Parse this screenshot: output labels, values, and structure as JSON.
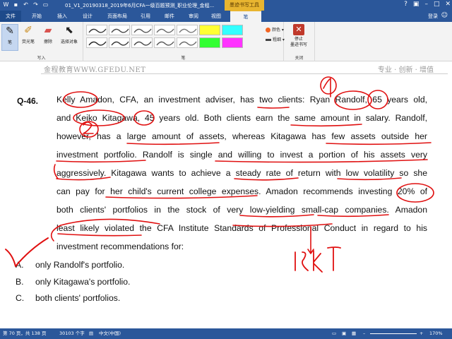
{
  "window": {
    "title": "01_V1_20190318_2019年6月CFA一级百题预测_职业伦理_金程...",
    "context_tool": "墨迹书写工具",
    "login": "登录"
  },
  "tabs": [
    "文件",
    "开始",
    "插入",
    "设计",
    "页面布局",
    "引用",
    "邮件",
    "审阅",
    "视图",
    "笔"
  ],
  "ribbon": {
    "write_group": {
      "label": "写入",
      "tools": [
        {
          "label": "笔",
          "icon": "pen-icon"
        },
        {
          "label": "荧光笔",
          "icon": "highlighter-icon"
        },
        {
          "label": "擦除",
          "icon": "eraser-icon"
        },
        {
          "label": "选择对象",
          "icon": "select-cursor-icon"
        }
      ]
    },
    "pens_group": {
      "label": "笔",
      "swatches": [
        {
          "color": "#333333",
          "kind": "line"
        },
        {
          "color": "#444444",
          "kind": "line"
        },
        {
          "color": "#555555",
          "kind": "line"
        },
        {
          "color": "#666666",
          "kind": "line"
        },
        {
          "color": "#777777",
          "kind": "line"
        },
        {
          "color": "#ffff33",
          "kind": "highlight"
        },
        {
          "color": "#33ffff",
          "kind": "highlight"
        },
        {
          "color": "#222222",
          "kind": "line"
        },
        {
          "color": "#333333",
          "kind": "line"
        },
        {
          "color": "#444444",
          "kind": "line"
        },
        {
          "color": "#555555",
          "kind": "line"
        },
        {
          "color": "#666666",
          "kind": "line"
        },
        {
          "color": "#33ff33",
          "kind": "highlight"
        },
        {
          "color": "#ff33ff",
          "kind": "highlight"
        }
      ],
      "color_label": "颜色",
      "thickness_label": "粗细"
    },
    "close_group": {
      "label": "关闭",
      "stop_label_line1": "停止",
      "stop_label_line2": "墨迹书写"
    }
  },
  "page_header": {
    "left": "金程教育WWW.GFEDU.NET",
    "right": "专业 · 创新 · 增值"
  },
  "question": {
    "number": "Q-46.",
    "lines": [
      "Kelly Amadon, CFA, an investment adviser, has two clients: Ryan Randolf, 65 years old,",
      "and Keiko Kitagawa, 45 years old. Both clients earn the same amount in salary. Randolf,",
      "however, has a large amount of assets, whereas Kitagawa has few assets outside her",
      "investment portfolio. Randolf is single and willing to invest a portion of his assets very",
      "aggressively. Kitagawa wants to achieve a steady rate of return with low volatility so she",
      "can pay for her child's current college expenses. Amadon recommends investing 20% of",
      "both clients' portfolios in the stock of very low-yielding small-cap companies. Amadon",
      "least likely violated the CFA Institute Standards of Professional Conduct in regard to his",
      "investment recommendations for:"
    ],
    "options": [
      {
        "letter": "A.",
        "text": "only Randolf's portfolio."
      },
      {
        "letter": "B.",
        "text": "only Kitagawa's portfolio."
      },
      {
        "letter": "C.",
        "text": "both clients' portfolios."
      }
    ]
  },
  "status": {
    "page": "第 70 页，共 138 页",
    "words": "30103 个字",
    "lang": "中文(中国)",
    "zoom": "170%"
  }
}
